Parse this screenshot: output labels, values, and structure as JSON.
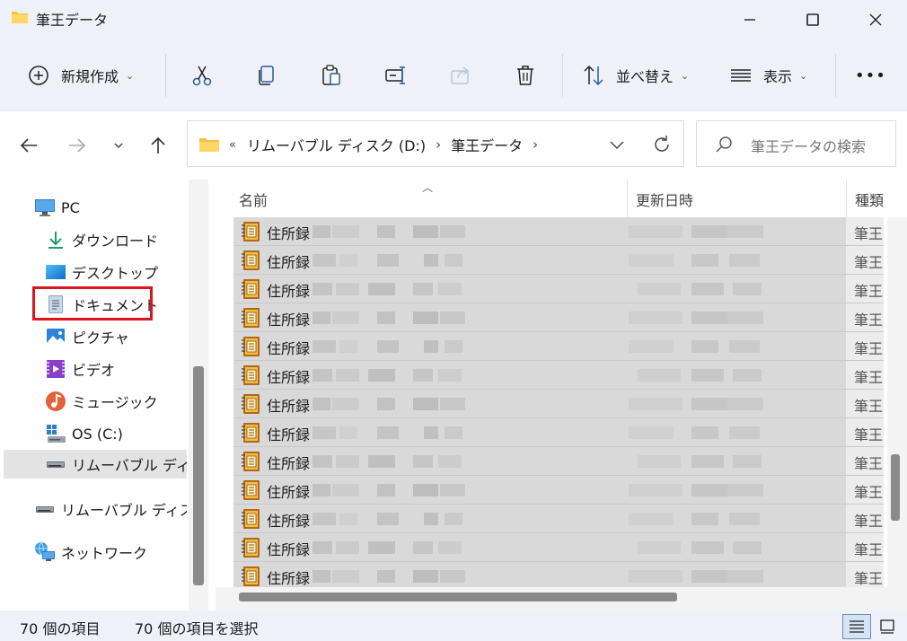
{
  "window": {
    "title": "筆王データ"
  },
  "commandbar": {
    "new_label": "新規作成",
    "sort_label": "並べ替え",
    "view_label": "表示",
    "more_label": "•••"
  },
  "address": {
    "overflow": "«",
    "crumbs": [
      "リムーバブル ディスク (D:)",
      "筆王データ"
    ],
    "separator": "›"
  },
  "search": {
    "placeholder": "筆王データの検索"
  },
  "sidebar": {
    "items": [
      {
        "label": "PC",
        "icon": "pc-icon"
      },
      {
        "label": "ダウンロード",
        "icon": "download-icon"
      },
      {
        "label": "デスクトップ",
        "icon": "desktop-icon"
      },
      {
        "label": "ドキュメント",
        "icon": "documents-icon"
      },
      {
        "label": "ピクチャ",
        "icon": "pictures-icon"
      },
      {
        "label": "ビデオ",
        "icon": "video-icon"
      },
      {
        "label": "ミュージック",
        "icon": "music-icon"
      },
      {
        "label": "OS (C:)",
        "icon": "windows-drive-icon"
      },
      {
        "label": "リムーバブル ディスク",
        "icon": "removable-drive-icon"
      },
      {
        "label": "リムーバブル ディスク",
        "icon": "removable-drive-icon"
      },
      {
        "label": "ネットワーク",
        "icon": "network-icon"
      }
    ]
  },
  "columns": {
    "name": "名前",
    "modified": "更新日時",
    "type": "種類"
  },
  "files": [
    {
      "name": "住所録",
      "type": "筆王"
    },
    {
      "name": "住所録",
      "type": "筆王"
    },
    {
      "name": "住所録",
      "type": "筆王"
    },
    {
      "name": "住所録",
      "type": "筆王"
    },
    {
      "name": "住所録",
      "type": "筆王"
    },
    {
      "name": "住所録",
      "type": "筆王"
    },
    {
      "name": "住所録",
      "type": "筆王"
    },
    {
      "name": "住所録",
      "type": "筆王"
    },
    {
      "name": "住所録",
      "type": "筆王"
    },
    {
      "name": "住所録",
      "type": "筆王"
    },
    {
      "name": "住所録",
      "type": "筆王"
    },
    {
      "name": "住所録",
      "type": "筆王"
    },
    {
      "name": "住所録",
      "type": "筆王"
    }
  ],
  "status": {
    "count": "70 個の項目",
    "selected": "70 個の項目を選択"
  },
  "colors": {
    "chrome": "#eef2f8",
    "highlight_box": "#e0141e",
    "rows_selected": "#d9d9d9",
    "folder": "#f4c242"
  }
}
